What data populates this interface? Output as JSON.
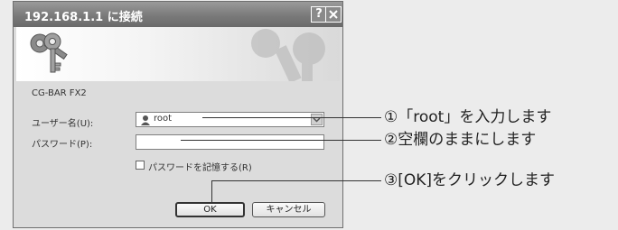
{
  "dialog": {
    "title": "192.168.1.1 に接続",
    "help_button": "?",
    "close_button": "✕",
    "server_name": "CG-BAR FX2",
    "user_label": "ユーザー名(U):",
    "user_value": "root",
    "password_label": "パスワード(P):",
    "password_value": "",
    "remember_label": "パスワードを記憶する(R)",
    "remember_checked": false,
    "ok_label": "OK",
    "cancel_label": "キャンセル"
  },
  "annotations": {
    "step1": "①「root」を入力します",
    "step2": "②空欄のままにします",
    "step3": "③[OK]をクリックします"
  },
  "icons": {
    "banner": "keys-icon",
    "user": "user-icon",
    "combo_arrow": "chevron-down-icon"
  },
  "colors": {
    "titlebar": "#7a7a7a",
    "dialog_bg": "#dcdcdc",
    "page_bg": "#ececec"
  }
}
